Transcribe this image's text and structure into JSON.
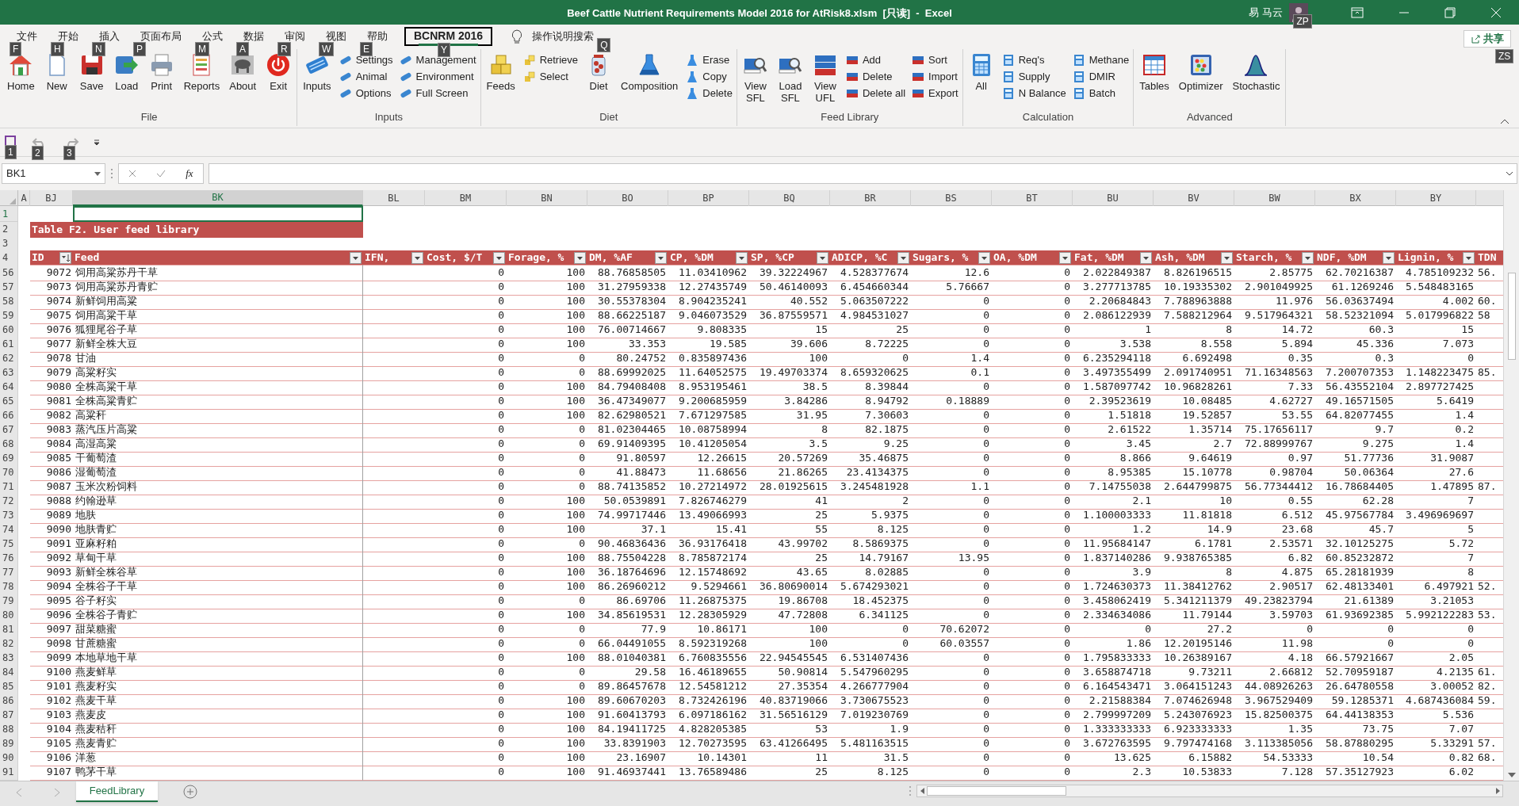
{
  "window": {
    "title": "Beef Cattle Nutrient Requirements Model 2016 for AtRisk8.xlsm  [只读]  -  Excel",
    "user": "易 马云",
    "account_keytip": "ZP"
  },
  "ribbon_tabs": [
    {
      "label": "文件",
      "keytip": "F",
      "selected": false
    },
    {
      "label": "开始",
      "keytip": "H",
      "selected": false
    },
    {
      "label": "插入",
      "keytip": "N",
      "selected": false
    },
    {
      "label": "页面布局",
      "keytip": "P",
      "selected": false
    },
    {
      "label": "公式",
      "keytip": "M",
      "selected": false
    },
    {
      "label": "数据",
      "keytip": "A",
      "selected": false
    },
    {
      "label": "审阅",
      "keytip": "R",
      "selected": false
    },
    {
      "label": "视图",
      "keytip": "W",
      "selected": false
    },
    {
      "label": "帮助",
      "keytip": "E",
      "selected": false
    },
    {
      "label": "BCNRM 2016",
      "keytip": "Y",
      "selected": true
    }
  ],
  "tell_me": {
    "label": "操作说明搜索",
    "keytip": "Q"
  },
  "share": {
    "label": "共享",
    "keytip": "ZS"
  },
  "ribbon_groups": [
    {
      "label": "File",
      "items": [
        {
          "label": "Home",
          "kind": "large"
        },
        {
          "label": "New",
          "kind": "large"
        },
        {
          "label": "Save",
          "kind": "large"
        },
        {
          "label": "Load",
          "kind": "large"
        },
        {
          "label": "Print",
          "kind": "large"
        },
        {
          "label": "Reports",
          "kind": "large"
        },
        {
          "label": "About",
          "kind": "large"
        },
        {
          "label": "Exit",
          "kind": "large"
        }
      ]
    },
    {
      "label": "Inputs",
      "items": [
        {
          "label": "Inputs",
          "kind": "large"
        },
        {
          "label": "Settings",
          "kind": "small"
        },
        {
          "label": "Animal",
          "kind": "small"
        },
        {
          "label": "Options",
          "kind": "small"
        },
        {
          "label": "Management",
          "kind": "small"
        },
        {
          "label": "Environment",
          "kind": "small"
        },
        {
          "label": "Full Screen",
          "kind": "small"
        }
      ]
    },
    {
      "label": "Diet",
      "items": [
        {
          "label": "Feeds",
          "kind": "large"
        },
        {
          "label": "Retrieve",
          "kind": "small"
        },
        {
          "label": "Select",
          "kind": "small"
        },
        {
          "label": "Diet",
          "kind": "large"
        },
        {
          "label": "Composition",
          "kind": "large"
        },
        {
          "label": "Erase",
          "kind": "small"
        },
        {
          "label": "Copy",
          "kind": "small"
        },
        {
          "label": "Delete",
          "kind": "small"
        }
      ]
    },
    {
      "label": "Feed Library",
      "items": [
        {
          "label": "View\nSFL",
          "kind": "large"
        },
        {
          "label": "Load\nSFL",
          "kind": "large"
        },
        {
          "label": "View\nUFL",
          "kind": "large"
        },
        {
          "label": "Add",
          "kind": "small"
        },
        {
          "label": "Delete",
          "kind": "small"
        },
        {
          "label": "Delete all",
          "kind": "small"
        },
        {
          "label": "Sort",
          "kind": "small"
        },
        {
          "label": "Import",
          "kind": "small"
        },
        {
          "label": "Export",
          "kind": "small"
        }
      ]
    },
    {
      "label": "Calculation",
      "items": [
        {
          "label": "All",
          "kind": "large"
        },
        {
          "label": "Req's",
          "kind": "small"
        },
        {
          "label": "Supply",
          "kind": "small"
        },
        {
          "label": "N Balance",
          "kind": "small"
        },
        {
          "label": "Methane",
          "kind": "small"
        },
        {
          "label": "DMIR",
          "kind": "small"
        },
        {
          "label": "Batch",
          "kind": "small"
        }
      ]
    },
    {
      "label": "Advanced",
      "items": [
        {
          "label": "Tables",
          "kind": "large"
        },
        {
          "label": "Optimizer",
          "kind": "large"
        },
        {
          "label": "Stochastic",
          "kind": "large"
        }
      ]
    }
  ],
  "quick_access": [
    {
      "keytip": "1",
      "disabled": false
    },
    {
      "keytip": "2",
      "disabled": true
    },
    {
      "keytip": "3",
      "disabled": true
    }
  ],
  "formula_bar": {
    "name_box": "BK1",
    "function_label": "fx"
  },
  "sheet": {
    "columns": [
      {
        "label": "A",
        "selected": false
      },
      {
        "label": "BJ",
        "selected": false
      },
      {
        "label": "BK",
        "selected": true
      },
      {
        "label": "BL",
        "selected": false
      },
      {
        "label": "BM",
        "selected": false
      },
      {
        "label": "BN",
        "selected": false
      },
      {
        "label": "BO",
        "selected": false
      },
      {
        "label": "BP",
        "selected": false
      },
      {
        "label": "BQ",
        "selected": false
      },
      {
        "label": "BR",
        "selected": false
      },
      {
        "label": "BS",
        "selected": false
      },
      {
        "label": "BT",
        "selected": false
      },
      {
        "label": "BU",
        "selected": false
      },
      {
        "label": "BV",
        "selected": false
      },
      {
        "label": "BW",
        "selected": false
      },
      {
        "label": "BX",
        "selected": false
      },
      {
        "label": "BY",
        "selected": false
      }
    ],
    "top_rows": [
      {
        "row": "1",
        "selected": true
      },
      {
        "row": "2",
        "selected": false
      },
      {
        "row": "3",
        "selected": false
      },
      {
        "row": "4",
        "selected": false
      }
    ],
    "title": "Table F2. User feed library",
    "header": [
      {
        "label": "ID",
        "filter": true,
        "sorted": true
      },
      {
        "label": "Feed",
        "filter": true,
        "sorted": false
      },
      {
        "label": "IFN,",
        "filter": true,
        "sorted": false
      },
      {
        "label": "Cost, $/T",
        "filter": true,
        "sorted": false
      },
      {
        "label": "Forage, %",
        "filter": true,
        "sorted": false
      },
      {
        "label": "DM, %AF",
        "filter": true,
        "sorted": false
      },
      {
        "label": "CP, %DM",
        "filter": true,
        "sorted": false
      },
      {
        "label": "SP, %CP",
        "filter": true,
        "sorted": false
      },
      {
        "label": "ADICP, %C",
        "filter": true,
        "sorted": false
      },
      {
        "label": "Sugars, %",
        "filter": true,
        "sorted": false
      },
      {
        "label": "OA, %DM",
        "filter": true,
        "sorted": false
      },
      {
        "label": "Fat, %DM",
        "filter": true,
        "sorted": false
      },
      {
        "label": "Ash, %DM",
        "filter": true,
        "sorted": false
      },
      {
        "label": "Starch, %",
        "filter": true,
        "sorted": false
      },
      {
        "label": "NDF, %DM",
        "filter": true,
        "sorted": false
      },
      {
        "label": "Lignin, %",
        "filter": true,
        "sorted": false
      },
      {
        "label": "TDN",
        "filter": false,
        "sorted": false
      }
    ],
    "rows": [
      {
        "row": "56",
        "cells": [
          "",
          "9072",
          "饲用高粱苏丹干草",
          "",
          "0",
          "100",
          "88.76858505",
          "11.03410962",
          "39.32224967",
          "4.528377674",
          "12.6",
          "0",
          "2.022849387",
          "8.826196515",
          "2.85775",
          "62.70216387",
          "4.785109232"
        ],
        "tdn": "56."
      },
      {
        "row": "57",
        "cells": [
          "",
          "9073",
          "饲用高粱苏丹青贮",
          "",
          "0",
          "100",
          "31.27959338",
          "12.27435749",
          "50.46140093",
          "6.454660344",
          "5.76667",
          "0",
          "3.277713785",
          "10.19335302",
          "2.901049925",
          "61.1269246",
          "5.548483165"
        ]
      },
      {
        "row": "58",
        "cells": [
          "",
          "9074",
          "新鲜饲用高粱",
          "",
          "0",
          "100",
          "30.55378304",
          "8.904235241",
          "40.552",
          "5.063507222",
          "0",
          "0",
          "2.20684843",
          "7.788963888",
          "11.976",
          "56.03637494",
          "4.002"
        ],
        "tdn": "60."
      },
      {
        "row": "59",
        "cells": [
          "",
          "9075",
          "饲用高粱干草",
          "",
          "0",
          "100",
          "88.66225187",
          "9.046073529",
          "36.87559571",
          "4.984531027",
          "0",
          "0",
          "2.086122939",
          "7.588212964",
          "9.517964321",
          "58.52321094",
          "5.017996822"
        ],
        "tdn": "58"
      },
      {
        "row": "60",
        "cells": [
          "",
          "9076",
          "狐狸尾谷子草",
          "",
          "0",
          "100",
          "76.00714667",
          "9.808335",
          "15",
          "25",
          "0",
          "0",
          "1",
          "8",
          "14.72",
          "60.3",
          "15"
        ]
      },
      {
        "row": "61",
        "cells": [
          "",
          "9077",
          "新鲜全株大豆",
          "",
          "0",
          "100",
          "33.353",
          "19.585",
          "39.606",
          "8.72225",
          "0",
          "0",
          "3.538",
          "8.558",
          "5.894",
          "45.336",
          "7.073"
        ]
      },
      {
        "row": "62",
        "cells": [
          "",
          "9078",
          "甘油",
          "",
          "0",
          "0",
          "80.24752",
          "0.835897436",
          "100",
          "0",
          "1.4",
          "0",
          "6.235294118",
          "6.692498",
          "0.35",
          "0.3",
          "0"
        ]
      },
      {
        "row": "63",
        "cells": [
          "",
          "9079",
          "高粱籽实",
          "",
          "0",
          "0",
          "88.69992025",
          "11.64052575",
          "19.49703374",
          "8.659320625",
          "0.1",
          "0",
          "3.497355499",
          "2.091740951",
          "71.16348563",
          "7.200707353",
          "1.148223475"
        ],
        "tdn": "85."
      },
      {
        "row": "64",
        "cells": [
          "",
          "9080",
          "全株高粱干草",
          "",
          "0",
          "100",
          "84.79408408",
          "8.953195461",
          "38.5",
          "8.39844",
          "0",
          "0",
          "1.587097742",
          "10.96828261",
          "7.33",
          "56.43552104",
          "2.897727425"
        ]
      },
      {
        "row": "65",
        "cells": [
          "",
          "9081",
          "全株高粱青贮",
          "",
          "0",
          "100",
          "36.47349077",
          "9.200685959",
          "3.84286",
          "8.94792",
          "0.18889",
          "0",
          "2.39523619",
          "10.08485",
          "4.62727",
          "49.16571505",
          "5.6419"
        ]
      },
      {
        "row": "66",
        "cells": [
          "",
          "9082",
          "高粱秆",
          "",
          "0",
          "100",
          "82.62980521",
          "7.671297585",
          "31.95",
          "7.30603",
          "0",
          "0",
          "1.51818",
          "19.52857",
          "53.55",
          "64.82077455",
          "1.4"
        ]
      },
      {
        "row": "67",
        "cells": [
          "",
          "9083",
          "蒸汽压片高粱",
          "",
          "0",
          "0",
          "81.02304465",
          "10.08758994",
          "8",
          "82.1875",
          "0",
          "0",
          "2.61522",
          "1.35714",
          "75.17656117",
          "9.7",
          "0.2"
        ]
      },
      {
        "row": "68",
        "cells": [
          "",
          "9084",
          "高湿高粱",
          "",
          "0",
          "0",
          "69.91409395",
          "10.41205054",
          "3.5",
          "9.25",
          "0",
          "0",
          "3.45",
          "2.7",
          "72.88999767",
          "9.275",
          "1.4"
        ]
      },
      {
        "row": "69",
        "cells": [
          "",
          "9085",
          "干葡萄渣",
          "",
          "0",
          "0",
          "91.80597",
          "12.26615",
          "20.57269",
          "35.46875",
          "0",
          "0",
          "8.866",
          "9.64619",
          "0.97",
          "51.77736",
          "31.9087"
        ]
      },
      {
        "row": "70",
        "cells": [
          "",
          "9086",
          "湿葡萄渣",
          "",
          "0",
          "0",
          "41.88473",
          "11.68656",
          "21.86265",
          "23.4134375",
          "0",
          "0",
          "8.95385",
          "15.10778",
          "0.98704",
          "50.06364",
          "27.6"
        ]
      },
      {
        "row": "71",
        "cells": [
          "",
          "9087",
          "玉米次粉饲料",
          "",
          "0",
          "0",
          "88.74135852",
          "10.27214972",
          "28.01925615",
          "3.245481928",
          "1.1",
          "0",
          "7.14755038",
          "2.644799875",
          "56.77344412",
          "16.78684405",
          "1.47895"
        ],
        "tdn": "87."
      },
      {
        "row": "72",
        "cells": [
          "",
          "9088",
          "约翰逊草",
          "",
          "0",
          "100",
          "50.0539891",
          "7.826746279",
          "41",
          "2",
          "0",
          "0",
          "2.1",
          "10",
          "0.55",
          "62.28",
          "7"
        ]
      },
      {
        "row": "73",
        "cells": [
          "",
          "9089",
          "地肤",
          "",
          "0",
          "100",
          "74.99717446",
          "13.49066993",
          "25",
          "5.9375",
          "0",
          "0",
          "1.100003333",
          "11.81818",
          "6.512",
          "45.97567784",
          "3.496969697"
        ]
      },
      {
        "row": "74",
        "cells": [
          "",
          "9090",
          "地肤青贮",
          "",
          "0",
          "100",
          "37.1",
          "15.41",
          "55",
          "8.125",
          "0",
          "0",
          "1.2",
          "14.9",
          "23.68",
          "45.7",
          "5"
        ]
      },
      {
        "row": "75",
        "cells": [
          "",
          "9091",
          "亚麻籽粕",
          "",
          "0",
          "0",
          "90.46836436",
          "36.93176418",
          "43.99702",
          "8.5869375",
          "0",
          "0",
          "11.95684147",
          "6.1781",
          "2.53571",
          "32.10125275",
          "5.72"
        ]
      },
      {
        "row": "76",
        "cells": [
          "",
          "9092",
          "草甸干草",
          "",
          "0",
          "100",
          "88.75504228",
          "8.785872174",
          "25",
          "14.79167",
          "13.95",
          "0",
          "1.837140286",
          "9.938765385",
          "6.82",
          "60.85232872",
          "7"
        ]
      },
      {
        "row": "77",
        "cells": [
          "",
          "9093",
          "新鲜全株谷草",
          "",
          "0",
          "100",
          "36.18764696",
          "12.15748692",
          "43.65",
          "8.02885",
          "0",
          "0",
          "3.9",
          "8",
          "4.875",
          "65.28181939",
          "8"
        ]
      },
      {
        "row": "78",
        "cells": [
          "",
          "9094",
          "全株谷子干草",
          "",
          "0",
          "100",
          "86.26960212",
          "9.5294661",
          "36.80690014",
          "5.674293021",
          "0",
          "0",
          "1.724630373",
          "11.38412762",
          "2.90517",
          "62.48133401",
          "6.497921"
        ],
        "tdn": "52."
      },
      {
        "row": "79",
        "cells": [
          "",
          "9095",
          "谷子籽实",
          "",
          "0",
          "0",
          "86.69706",
          "11.26875375",
          "19.86708",
          "18.452375",
          "0",
          "0",
          "3.458062419",
          "5.341211379",
          "49.23823794",
          "21.61389",
          "3.21053"
        ]
      },
      {
        "row": "80",
        "cells": [
          "",
          "9096",
          "全株谷子青贮",
          "",
          "0",
          "100",
          "34.85619531",
          "12.28305929",
          "47.72808",
          "6.341125",
          "0",
          "0",
          "2.334634086",
          "11.79144",
          "3.59703",
          "61.93692385",
          "5.992122283"
        ],
        "tdn": "53."
      },
      {
        "row": "81",
        "cells": [
          "",
          "9097",
          "甜菜糖蜜",
          "",
          "0",
          "0",
          "77.9",
          "10.86171",
          "100",
          "0",
          "70.62072",
          "0",
          "0",
          "27.2",
          "0",
          "0",
          "0"
        ]
      },
      {
        "row": "82",
        "cells": [
          "",
          "9098",
          "甘蔗糖蜜",
          "",
          "0",
          "0",
          "66.04491055",
          "8.592319268",
          "100",
          "0",
          "60.03557",
          "0",
          "1.86",
          "12.20195146",
          "11.98",
          "0",
          "0"
        ]
      },
      {
        "row": "83",
        "cells": [
          "",
          "9099",
          "本地草地干草",
          "",
          "0",
          "100",
          "88.01040381",
          "6.760835556",
          "22.94545545",
          "6.531407436",
          "0",
          "0",
          "1.795833333",
          "10.26389167",
          "4.18",
          "66.57921667",
          "2.05"
        ]
      },
      {
        "row": "84",
        "cells": [
          "",
          "9100",
          "燕麦鲜草",
          "",
          "0",
          "0",
          "29.58",
          "16.46189655",
          "50.90814",
          "5.547960295",
          "0",
          "0",
          "3.658874718",
          "9.73211",
          "2.66812",
          "52.70959187",
          "4.2135"
        ],
        "tdn": "61."
      },
      {
        "row": "85",
        "cells": [
          "",
          "9101",
          "燕麦籽实",
          "",
          "0",
          "0",
          "89.86457678",
          "12.54581212",
          "27.35354",
          "4.266777904",
          "0",
          "0",
          "6.164543471",
          "3.064151243",
          "44.08926263",
          "26.64780558",
          "3.00052"
        ],
        "tdn": "82."
      },
      {
        "row": "86",
        "cells": [
          "",
          "9102",
          "燕麦干草",
          "",
          "0",
          "100",
          "89.60670203",
          "8.732426196",
          "40.83719066",
          "3.730675523",
          "0",
          "0",
          "2.21588384",
          "7.074626948",
          "3.967529409",
          "59.1285371",
          "4.687436084"
        ],
        "tdn": "59."
      },
      {
        "row": "87",
        "cells": [
          "",
          "9103",
          "燕麦皮",
          "",
          "0",
          "100",
          "91.60413793",
          "6.097186162",
          "31.56516129",
          "7.019230769",
          "0",
          "0",
          "2.799997209",
          "5.243076923",
          "15.82500375",
          "64.44138353",
          "5.536"
        ]
      },
      {
        "row": "88",
        "cells": [
          "",
          "9104",
          "燕麦秸秆",
          "",
          "0",
          "100",
          "84.19411725",
          "4.828205385",
          "53",
          "1.9",
          "0",
          "0",
          "1.333333333",
          "6.923333333",
          "1.35",
          "73.75",
          "7.07"
        ]
      },
      {
        "row": "89",
        "cells": [
          "",
          "9105",
          "燕麦青贮",
          "",
          "0",
          "100",
          "33.8391903",
          "12.70273595",
          "63.41266495",
          "5.481163515",
          "0",
          "0",
          "3.672763595",
          "9.797474168",
          "3.113385056",
          "58.87880295",
          "5.33291"
        ],
        "tdn": "57."
      },
      {
        "row": "90",
        "cells": [
          "",
          "9106",
          "洋葱",
          "",
          "0",
          "100",
          "23.16907",
          "10.14301",
          "11",
          "31.5",
          "0",
          "0",
          "13.625",
          "6.15882",
          "54.53333",
          "10.54",
          "0.82"
        ],
        "tdn": "68."
      },
      {
        "row": "91",
        "cells": [
          "",
          "9107",
          "鸭茅干草",
          "",
          "0",
          "100",
          "91.46937441",
          "13.76589486",
          "25",
          "8.125",
          "0",
          "0",
          "2.3",
          "10.53833",
          "7.128",
          "57.35127923",
          "6.02"
        ]
      }
    ]
  },
  "sheet_tabs": [
    {
      "label": "FeedLibrary",
      "selected": true
    }
  ]
}
